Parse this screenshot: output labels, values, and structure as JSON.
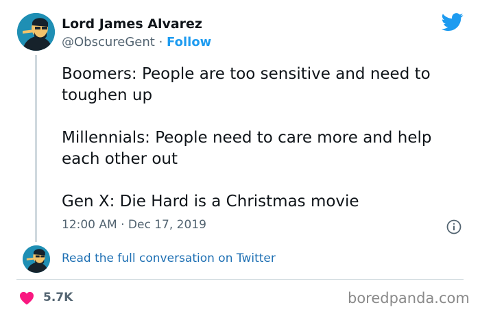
{
  "author": {
    "name": "Lord James Alvarez",
    "handle": "@ObscureGent",
    "separator": "·",
    "follow_label": "Follow"
  },
  "tweet": {
    "paragraphs": [
      "Boomers: People are too sensitive and need to toughen up",
      "Millennials: People need to care more and help each other out",
      "Gen X: Die Hard is a Christmas movie"
    ],
    "timestamp": "12:00 AM · Dec 17, 2019"
  },
  "thread": {
    "read_link": "Read the full conversation on Twitter"
  },
  "engagement": {
    "likes": "5.7K"
  },
  "watermark": "boredpanda.com",
  "icons": {
    "logo": "twitter-bird-icon",
    "info": "info-icon",
    "like": "heart-icon"
  },
  "colors": {
    "twitter_blue": "#1d9bf0",
    "link": "#1d6fb3",
    "heart": "#f91880",
    "secondary_text": "#536471",
    "avatar_bg": "#1f8fb4"
  }
}
